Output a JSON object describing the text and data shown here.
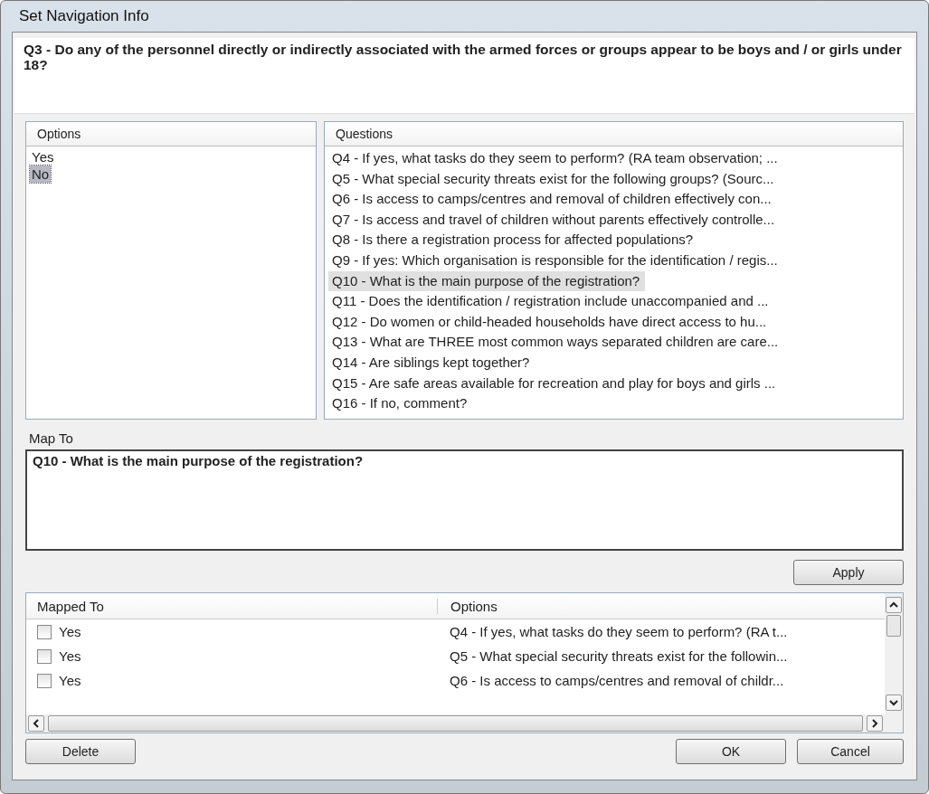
{
  "window": {
    "title": "Set Navigation Info"
  },
  "question": {
    "text": "Q3 - Do any of the personnel directly or indirectly associated with the armed forces or groups appear to be boys and / or girls under 18?"
  },
  "options_list": {
    "header": "Options",
    "items": [
      {
        "label": "Yes",
        "selected": false
      },
      {
        "label": "No",
        "selected": true
      }
    ]
  },
  "questions_list": {
    "header": "Questions",
    "items": [
      {
        "label": "Q4 - If yes, what tasks do they seem to perform? (RA team observation; ...",
        "selected": false
      },
      {
        "label": "Q5 - What special security threats exist for the following groups?  (Sourc...",
        "selected": false
      },
      {
        "label": "Q6 - Is access to camps/centres and removal of children effectively con...",
        "selected": false
      },
      {
        "label": "Q7 - Is access and travel of children without parents effectively controlle...",
        "selected": false
      },
      {
        "label": "Q8 - Is there a registration process for affected populations?",
        "selected": false
      },
      {
        "label": "Q9 - If yes: Which organisation is responsible for the identification / regis...",
        "selected": false
      },
      {
        "label": "Q10 - What is the main purpose of the registration?",
        "selected": true
      },
      {
        "label": "Q11 - Does the identification / registration include unaccompanied and ...",
        "selected": false
      },
      {
        "label": "Q12 - Do women or child-headed households have direct access to hu...",
        "selected": false
      },
      {
        "label": "Q13 - What are THREE most common ways separated children are care...",
        "selected": false
      },
      {
        "label": "Q14 - Are siblings kept together?",
        "selected": false
      },
      {
        "label": "Q15 - Are safe areas available for recreation and play for boys and girls ...",
        "selected": false
      },
      {
        "label": "Q16 - If no, comment?",
        "selected": false
      }
    ]
  },
  "map_to": {
    "label": "Map To",
    "value": "Q10 - What is the main purpose of the registration?"
  },
  "apply_button": "Apply",
  "mapped_table": {
    "columns": [
      "Mapped To",
      "Options"
    ],
    "rows": [
      {
        "checked": false,
        "mapped_to": "Yes",
        "option": "Q4 - If yes, what tasks do they seem to perform? (RA t..."
      },
      {
        "checked": false,
        "mapped_to": "Yes",
        "option": "Q5 - What special security threats exist for the followin..."
      },
      {
        "checked": false,
        "mapped_to": "Yes",
        "option": "Q6 - Is access to camps/centres and removal of childr..."
      }
    ]
  },
  "buttons": {
    "delete": "Delete",
    "ok": "OK",
    "cancel": "Cancel"
  }
}
